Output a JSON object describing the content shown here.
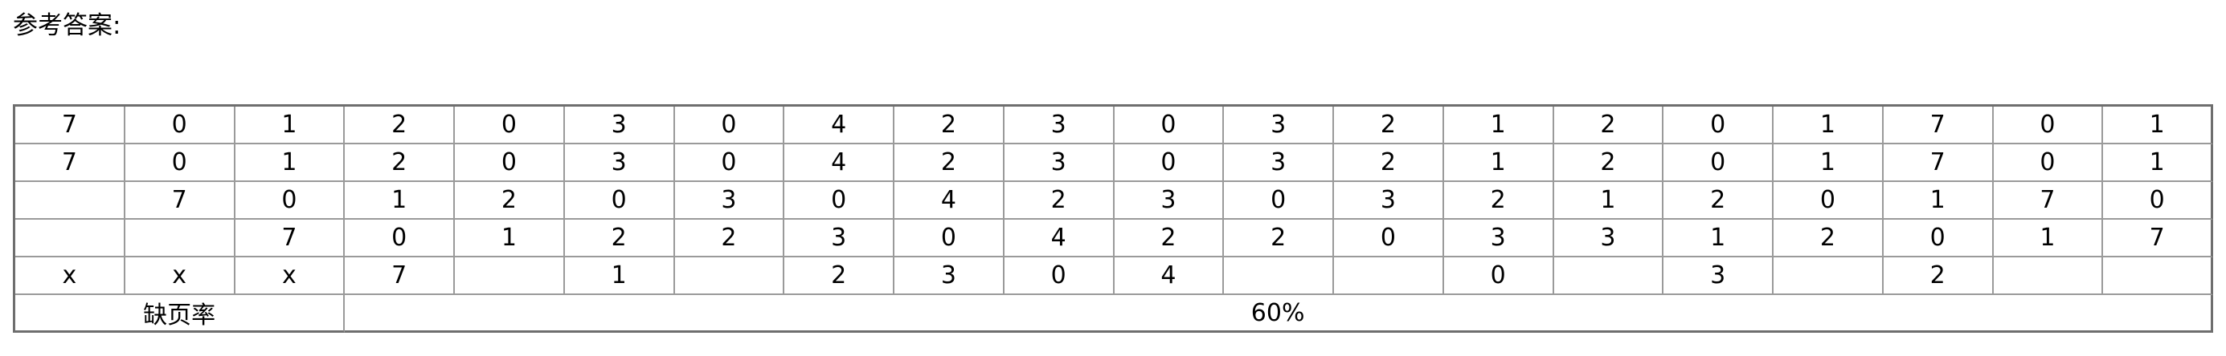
{
  "heading": "参考答案:",
  "table": {
    "rows": [
      [
        "7",
        "0",
        "1",
        "2",
        "0",
        "3",
        "0",
        "4",
        "2",
        "3",
        "0",
        "3",
        "2",
        "1",
        "2",
        "0",
        "1",
        "7",
        "0",
        "1"
      ],
      [
        "7",
        "0",
        "1",
        "2",
        "0",
        "3",
        "0",
        "4",
        "2",
        "3",
        "0",
        "3",
        "2",
        "1",
        "2",
        "0",
        "1",
        "7",
        "0",
        "1"
      ],
      [
        "",
        "7",
        "0",
        "1",
        "2",
        "0",
        "3",
        "0",
        "4",
        "2",
        "3",
        "0",
        "3",
        "2",
        "1",
        "2",
        "0",
        "1",
        "7",
        "0"
      ],
      [
        "",
        "",
        "7",
        "0",
        "1",
        "2",
        "2",
        "3",
        "0",
        "4",
        "2",
        "2",
        "0",
        "3",
        "3",
        "1",
        "2",
        "0",
        "1",
        "7"
      ],
      [
        "x",
        "x",
        "x",
        "7",
        "",
        "1",
        "",
        "2",
        "3",
        "0",
        "4",
        "",
        "",
        "0",
        "",
        "3",
        "",
        "2",
        "",
        ""
      ]
    ],
    "fault_label": "缺页率",
    "fault_value": "60%"
  }
}
